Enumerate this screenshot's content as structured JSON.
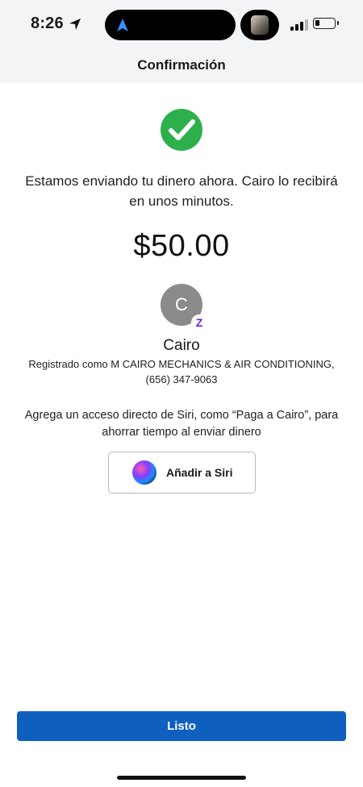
{
  "status_bar": {
    "time": "8:26",
    "location_icon": "location-arrow-icon",
    "signal_icon": "cellular-signal-icon",
    "battery_icon": "battery-low-icon"
  },
  "header": {
    "title": "Confirmación"
  },
  "confirmation": {
    "icon": "check-circle-icon",
    "icon_color": "#2db04b",
    "message": "Estamos enviando tu dinero ahora. Cairo lo recibirá en unos minutos.",
    "amount": "$50.00"
  },
  "recipient": {
    "avatar_initial": "C",
    "badge_letter": "Z",
    "badge_color": "#6d1ed4",
    "name": "Cairo",
    "registered_as": "Registrado como M CAIRO MECHANICS & AIR CONDITIONING,",
    "phone": "(656) 347-9063"
  },
  "siri": {
    "prompt": "Agrega un acceso directo de Siri, como “Paga a Cairo”, para ahorrar tiempo al enviar dinero",
    "button_label": "Añadir a Siri"
  },
  "footer": {
    "done_label": "Listo",
    "done_color": "#0f5fbf"
  }
}
